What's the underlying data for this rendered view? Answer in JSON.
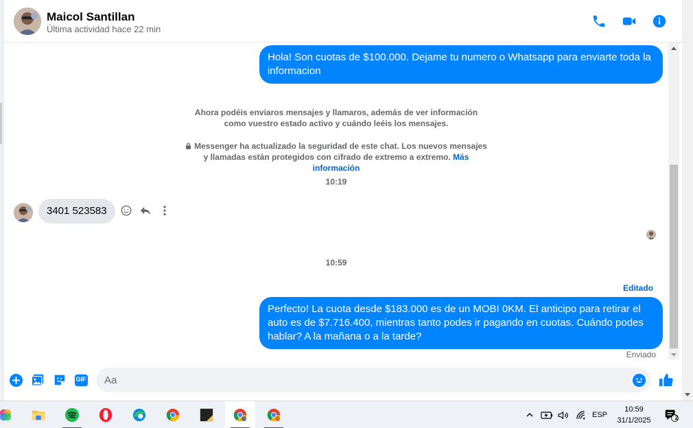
{
  "contact": {
    "name": "Maicol Santillan",
    "status": "Última actividad hace 22 min"
  },
  "messages": {
    "out_1": "Hola! Son cuotas de $100.000. Dejame tu numero o Whatsapp para enviarte toda la informacion",
    "system_1": "Ahora podéis enviaros mensajes y llamaros, además de ver información como vuestro estado activo y cuándo leéis los mensajes.",
    "system_2": "Messenger ha actualizado la seguridad de este chat. Los nuevos mensajes y llamadas están protegidos con cifrado de extremo a extremo.",
    "system_2_link": "Más información",
    "time_1": "10:19",
    "in_1": "3401 523583",
    "time_2": "10:59",
    "edited_label": "Editado",
    "out_2": "Perfecto! La cuota desde $183.000 es de un MOBI 0KM. El anticipo para retirar el auto es de $7.716.400, mientras tanto podes ir pagando en cuotas. Cuándo podes hablar? A la mañana o a la tarde?",
    "sent_status": "Enviado"
  },
  "composer": {
    "placeholder": "Aa",
    "gif_label": "GIF"
  },
  "taskbar": {
    "language": "ESP",
    "time": "10:59",
    "date": "31/1/2025",
    "notification_count": "2"
  },
  "colors": {
    "accent": "#0084ff",
    "incoming_bubble": "#e4e6eb",
    "link": "#0064d1"
  }
}
